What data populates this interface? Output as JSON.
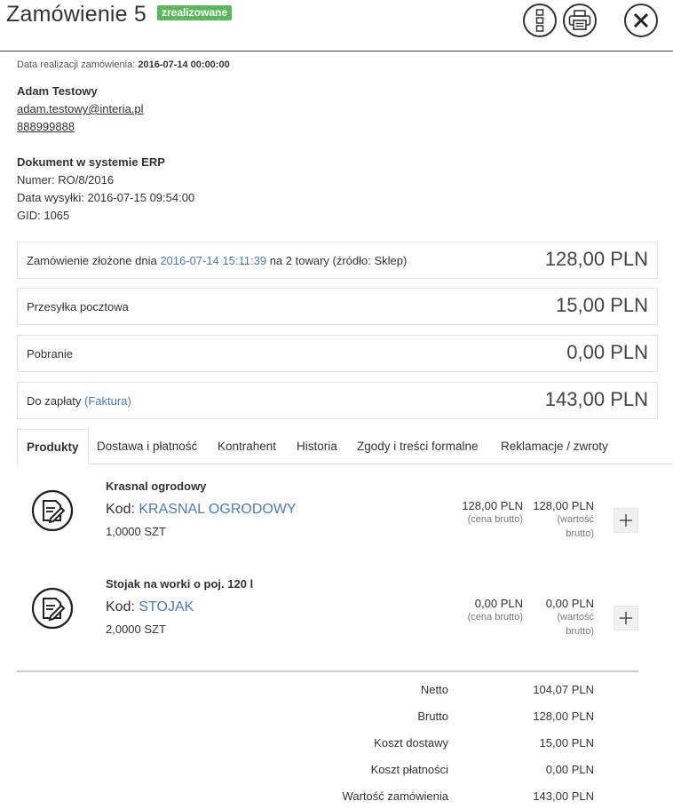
{
  "header": {
    "title": "Zamówienie 5",
    "status": "zrealizowane",
    "status_color": "#5cb85c"
  },
  "meta": {
    "date_label": "Data realizacji zamówienia:",
    "date_value": "2016-07-14 00:00:00"
  },
  "customer": {
    "name": "Adam Testowy",
    "email": "adam.testowy@interia.pl",
    "phone": "888999888"
  },
  "erp": {
    "title": "Dokument w systemie ERP",
    "number": "Numer: RO/8/2016",
    "sent": "Data wysyłki: 2016-07-15 09:54:00",
    "gid": "GID: 1065"
  },
  "summary": {
    "order_prefix": "Zamówienie złożone dnia",
    "order_date": "2016-07-14 15:11:39",
    "order_suffix": "na 2 towary (źródło: Sklep)",
    "order_amount": "128,00 PLN",
    "shipping_label": "Przesyłka pocztowa",
    "shipping_amount": "15,00 PLN",
    "payment_label": "Pobranie",
    "payment_amount": "0,00 PLN",
    "due_label": "Do zapłaty",
    "due_link": "(Faktura)",
    "due_amount": "143,00 PLN",
    "link_color": "#4a7bb7"
  },
  "tabs": [
    {
      "label": "Produkty"
    },
    {
      "label": "Dostawa i płatność"
    },
    {
      "label": "Kontrahent"
    },
    {
      "label": "Historia"
    },
    {
      "label": "Zgody i treści formalne"
    },
    {
      "label": "Reklamacje / zwroty"
    }
  ],
  "products": [
    {
      "name": "Krasnal ogrodowy",
      "code_label": "Kod:",
      "code": "KRASNAL OGRODOWY",
      "qty": "1,0000 SZT",
      "price": "128,00 PLN",
      "price_sub": "(cena brutto)",
      "value": "128,00 PLN",
      "value_sub1": "(wartość",
      "value_sub2": "brutto)"
    },
    {
      "name": "Stojak na worki o poj. 120 l",
      "code_label": "Kod:",
      "code": "STOJAK",
      "qty": "2,0000 SZT",
      "price": "0,00 PLN",
      "price_sub": "(cena brutto)",
      "value": "0,00 PLN",
      "value_sub1": "(wartość",
      "value_sub2": "brutto)"
    }
  ],
  "totals": [
    {
      "label": "Netto",
      "value": "104,07 PLN"
    },
    {
      "label": "Brutto",
      "value": "128,00 PLN"
    },
    {
      "label": "Koszt dostawy",
      "value": "15,00 PLN"
    },
    {
      "label": "Koszt płatności",
      "value": "0,00 PLN"
    },
    {
      "label": "Wartość zamówienia",
      "value": "143,00 PLN"
    }
  ],
  "icons": {
    "menu": "vertical-menu-icon",
    "print": "printer-icon",
    "close": "close-x-icon",
    "product": "edit-document-icon",
    "add": "plus-icon"
  }
}
